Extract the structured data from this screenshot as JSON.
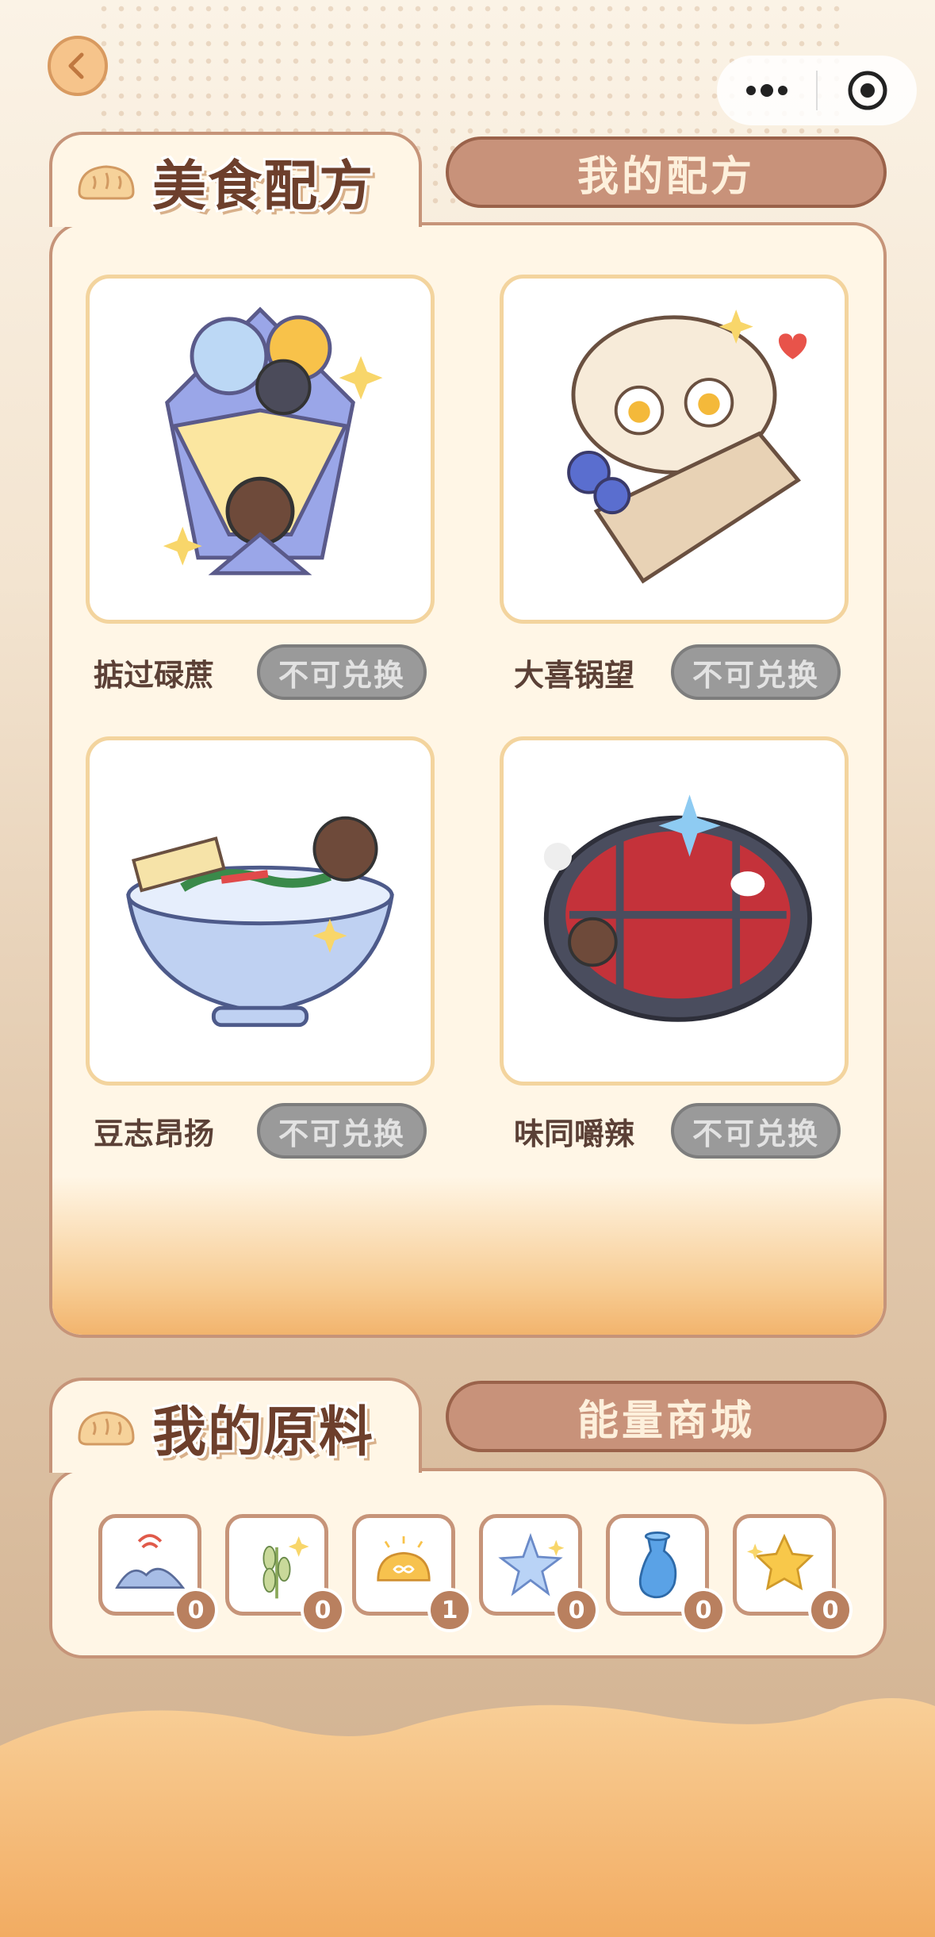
{
  "nav": {
    "back_icon": "chevron-left-icon",
    "more_icon": "more-dots-icon",
    "close_icon": "target-close-icon"
  },
  "recipes_section": {
    "title": "美食配方",
    "tab_button": "我的配方",
    "items": [
      {
        "name": "掂过碌蔗",
        "status": "不可兑换",
        "icon": "bouquet-dish"
      },
      {
        "name": "大喜锅望",
        "status": "不可兑换",
        "icon": "bread-bag-dish"
      },
      {
        "name": "豆志昂扬",
        "status": "不可兑换",
        "icon": "noodle-bowl-dish"
      },
      {
        "name": "味同嚼辣",
        "status": "不可兑换",
        "icon": "hotpot-dish"
      }
    ]
  },
  "ingredients_section": {
    "title": "我的原料",
    "tab_button": "能量商城",
    "items": [
      {
        "icon": "mountain-signal-icon",
        "count": "0"
      },
      {
        "icon": "wheat-icon",
        "count": "0"
      },
      {
        "icon": "bun-infinity-icon",
        "count": "1"
      },
      {
        "icon": "ice-star-icon",
        "count": "0"
      },
      {
        "icon": "blue-vase-icon",
        "count": "0"
      },
      {
        "icon": "gold-star-icon",
        "count": "0"
      }
    ]
  },
  "colors": {
    "accent": "#c8927a",
    "panel_border": "#c69479",
    "disabled_button": "#9a9a9a",
    "count_badge": "#b9805f"
  }
}
